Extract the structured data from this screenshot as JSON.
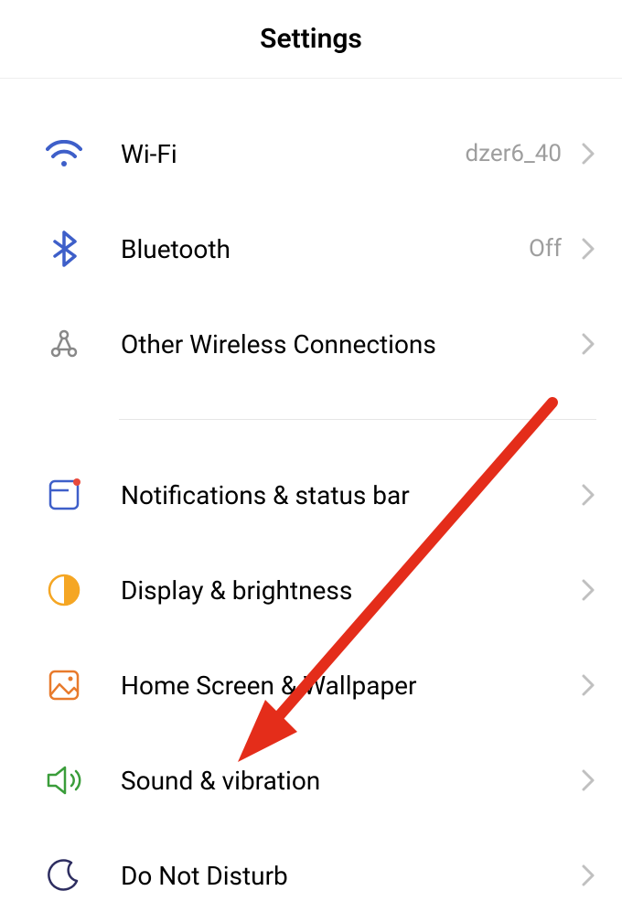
{
  "header": {
    "title": "Settings"
  },
  "section1": [
    {
      "icon": "wifi-icon",
      "label": "Wi-Fi",
      "value": "dzer6_40"
    },
    {
      "icon": "bluetooth-icon",
      "label": "Bluetooth",
      "value": "Off"
    },
    {
      "icon": "wireless-icon",
      "label": "Other Wireless Connections",
      "value": ""
    }
  ],
  "section2": [
    {
      "icon": "notifications-icon",
      "label": "Notifications & status bar",
      "value": ""
    },
    {
      "icon": "display-icon",
      "label": "Display & brightness",
      "value": ""
    },
    {
      "icon": "wallpaper-icon",
      "label": "Home Screen & Wallpaper",
      "value": ""
    },
    {
      "icon": "sound-icon",
      "label": "Sound & vibration",
      "value": ""
    },
    {
      "icon": "dnd-icon",
      "label": "Do Not Disturb",
      "value": ""
    }
  ]
}
